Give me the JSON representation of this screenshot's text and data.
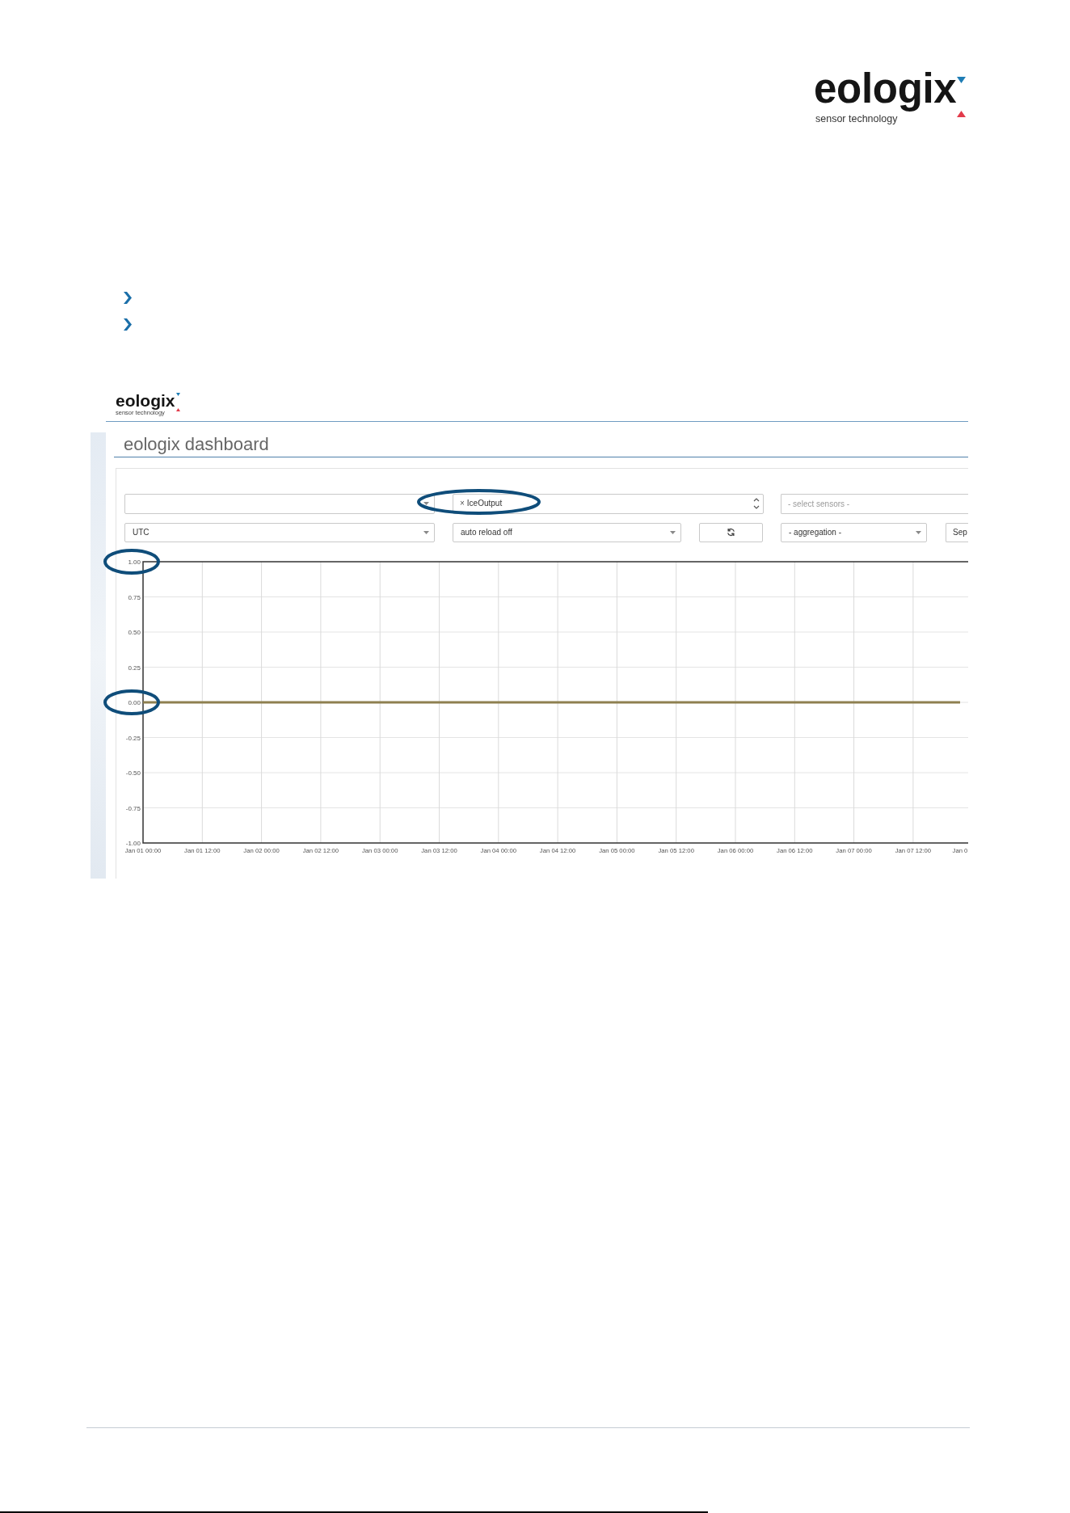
{
  "page_logo": {
    "wordmark": "eologix",
    "tagline": "sensor technology"
  },
  "bullets": [
    {
      "kind": "chevron"
    },
    {
      "kind": "chevron"
    }
  ],
  "dashboard": {
    "logo": {
      "wordmark": "eologix",
      "tagline": "sensor technology"
    },
    "title": "eologix dashboard",
    "control_rows": [
      {
        "controls": [
          {
            "kind": "select"
          },
          {
            "kind": "multiselect",
            "tags": [
              {
                "remove": "×",
                "label": "IceOutput",
                "highlighted": true
              }
            ]
          },
          {
            "kind": "multiselect",
            "placeholder": "- select sensors -"
          }
        ]
      },
      {
        "controls": [
          {
            "kind": "select",
            "value": "UTC"
          },
          {
            "kind": "select",
            "value": "auto reload off"
          },
          {
            "kind": "iconbutton"
          },
          {
            "kind": "select",
            "value": "- aggregation -"
          },
          {
            "kind": "button",
            "label": "Sep"
          }
        ]
      }
    ],
    "chart": {
      "chart_data": {
        "type": "line",
        "categories": [
          "Jan 01 00:00",
          "Jan 01 12:00",
          "Jan 02 00:00",
          "Jan 02 12:00",
          "Jan 03 00:00",
          "Jan 03 12:00",
          "Jan 04 00:00",
          "Jan 04 12:00",
          "Jan 05 00:00",
          "Jan 05 12:00",
          "Jan 06 00:00",
          "Jan 06 12:00",
          "Jan 07 00:00",
          "Jan 07 12:00",
          "Jan 0"
        ],
        "series": [
          {
            "color": "#8e8050",
            "values": [
              0,
              0,
              0,
              0,
              0,
              0,
              0,
              0,
              0,
              0,
              0,
              0,
              0,
              0,
              0
            ]
          }
        ],
        "ylim": [
          -1,
          1
        ],
        "yticks": [
          {
            "value": 1,
            "label": "1.00"
          },
          {
            "value": 0.75,
            "label": "0.75"
          },
          {
            "value": 0.5,
            "label": "0.50"
          },
          {
            "value": 0.25,
            "label": "0.25"
          },
          {
            "value": 0,
            "label": "0.00"
          },
          {
            "value": -0.25,
            "label": "-0.25"
          },
          {
            "value": -0.5,
            "label": "-0.50"
          },
          {
            "value": -0.75,
            "label": "-0.75"
          },
          {
            "value": -1,
            "label": "-1.00"
          }
        ],
        "grid": true
      },
      "tick_label_marks": [
        {
          "highlighted": true
        },
        {
          "highlighted": false
        },
        {
          "highlighted": false
        },
        {
          "highlighted": false
        },
        {
          "highlighted": true
        },
        {
          "highlighted": false
        },
        {
          "highlighted": false
        },
        {
          "highlighted": false
        },
        {
          "highlighted": false
        }
      ]
    }
  }
}
